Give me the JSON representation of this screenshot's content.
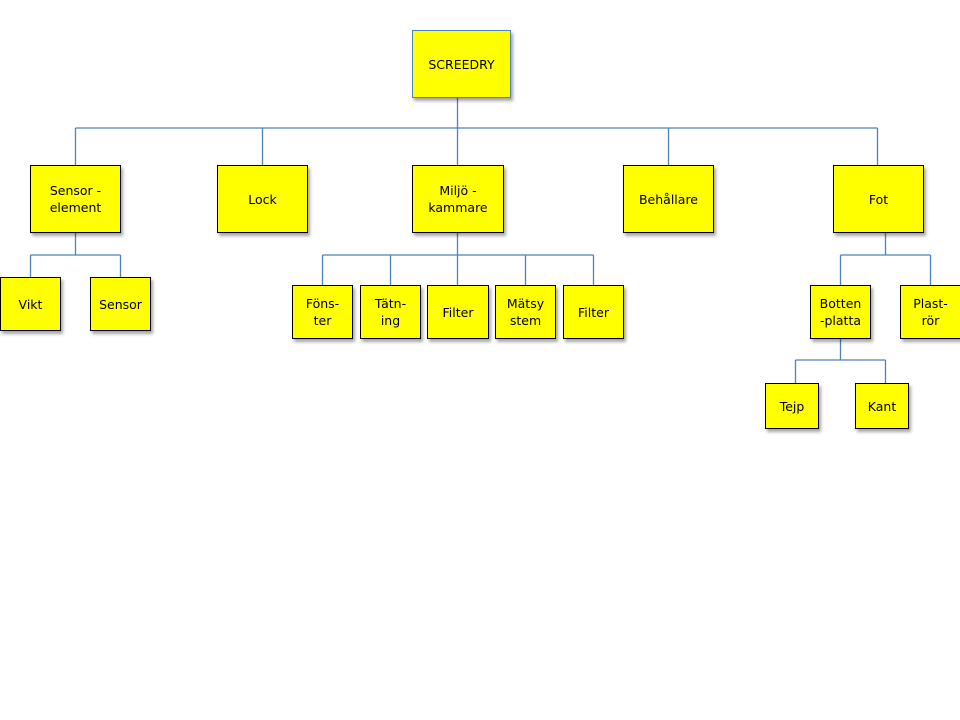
{
  "diagram": {
    "type": "org-chart",
    "colors": {
      "box_fill": "#ffff00",
      "connector": "#4f81bd",
      "root_border": "#4f81bd",
      "box_border": "#000000"
    },
    "root": {
      "label": "SCREEDRY"
    },
    "level1": [
      {
        "label": "Sensor -\nelement"
      },
      {
        "label": "Lock"
      },
      {
        "label": "Miljö -\nkammare"
      },
      {
        "label": "Behållare"
      },
      {
        "label": "Fot"
      }
    ],
    "sensor_children": [
      {
        "label": "Vikt"
      },
      {
        "label": "Sensor"
      }
    ],
    "miljo_children": [
      {
        "label": "Föns-\nter"
      },
      {
        "label": "Tätn-\ning"
      },
      {
        "label": "Filter"
      },
      {
        "label": "Mätsy\nstem"
      },
      {
        "label": "Filter"
      }
    ],
    "fot_children": [
      {
        "label": "Botten\n-platta"
      },
      {
        "label": "Plast-\nrör"
      }
    ],
    "botten_children": [
      {
        "label": "Tejp"
      },
      {
        "label": "Kant"
      }
    ]
  }
}
